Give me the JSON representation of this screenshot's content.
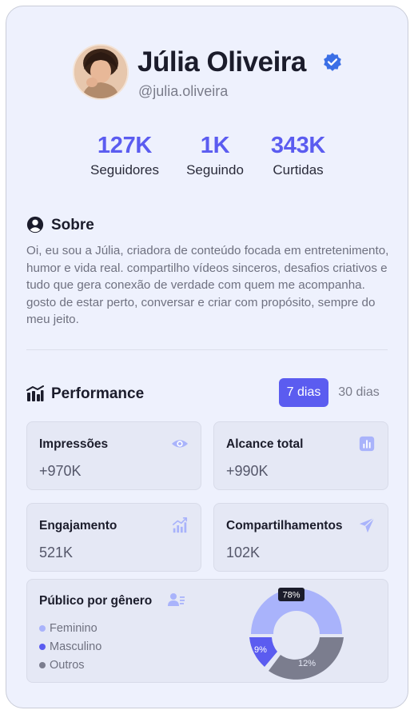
{
  "profile": {
    "name": "Júlia Oliveira",
    "handle": "@julia.oliveira",
    "verified": true
  },
  "stats": [
    {
      "value": "127K",
      "label": "Seguidores"
    },
    {
      "value": "1K",
      "label": "Seguindo"
    },
    {
      "value": "343K",
      "label": "Curtidas"
    }
  ],
  "about": {
    "title": "Sobre",
    "text": "Oi, eu sou a Júlia, criadora de conteúdo focada em entretenimento, humor e vida real. compartilho vídeos sinceros, desafios criativos e tudo que gera conexão de verdade com quem me acompanha. gosto de estar perto, conversar e criar com propósito, sempre do meu jeito."
  },
  "performance": {
    "title": "Performance",
    "tabs": {
      "active": "7 dias",
      "inactive": "30 dias"
    },
    "metrics": [
      {
        "title": "Impressões",
        "value": "+970K",
        "icon": "eye-icon"
      },
      {
        "title": "Alcance total",
        "value": "+990K",
        "icon": "bar-chart-icon"
      },
      {
        "title": "Engajamento",
        "value": "521K",
        "icon": "growth-chart-icon"
      },
      {
        "title": "Compartilhamentos",
        "value": "102K",
        "icon": "send-icon"
      }
    ]
  },
  "audience": {
    "title": "Público por gênero",
    "legend": [
      {
        "label": "Feminino",
        "color": "#a9b3fb"
      },
      {
        "label": "Masculino",
        "color": "#5b5cf0"
      },
      {
        "label": "Outros",
        "color": "#7b7d8e"
      }
    ],
    "chart_labels": {
      "feminino": "78%",
      "masculino": "9%",
      "outros": "12%"
    }
  },
  "colors": {
    "accent": "#5b5cf0",
    "light_accent": "#a9b3fb",
    "gray": "#7b7d8e",
    "background": "#eef1fd"
  }
}
